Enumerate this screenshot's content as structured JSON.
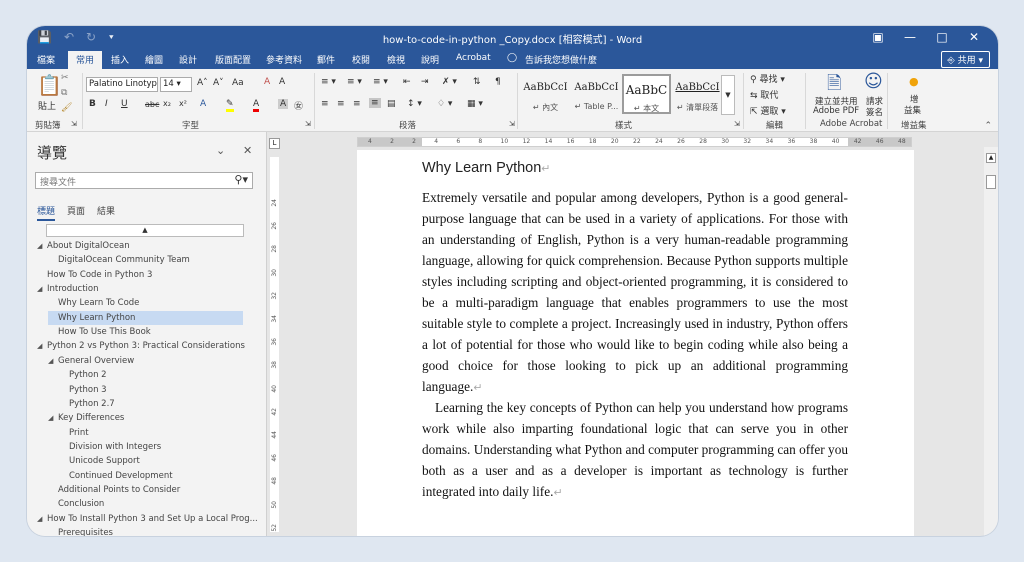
{
  "titlebar": {
    "doc_title": "how-to-code-in-python _Copy.docx [相容模式] - Word",
    "save_icon": "save-icon",
    "customize": "⯆"
  },
  "tabs": [
    "檔案",
    "常用",
    "插入",
    "繪圖",
    "設計",
    "版面配置",
    "參考資料",
    "郵件",
    "校閱",
    "檢視",
    "說明",
    "Acrobat"
  ],
  "active_tab": "常用",
  "tell_me": "告訴我您想做什麼",
  "share_label": "共用",
  "ribbon": {
    "clipboard": {
      "paste_label": "貼上",
      "group_label": "剪貼簿"
    },
    "font": {
      "font_name": "Palatino Linotyp",
      "font_size": "14",
      "group_label": "字型",
      "bold": "B",
      "italic": "I",
      "underline": "U",
      "strike": "abc",
      "sub": "x₂",
      "sup": "x²",
      "grow": "A˄",
      "shrink": "A˅",
      "case": "Aa",
      "clear": "A",
      "effects": "A",
      "color": "A",
      "border_char": "A",
      "phonetic": "A",
      "enclose": "㊛"
    },
    "paragraph": {
      "group_label": "段落"
    },
    "styles": {
      "group_label": "樣式",
      "items": [
        {
          "sample": "AaBbCcI",
          "name": "↵ 內文"
        },
        {
          "sample": "AaBbCcI",
          "name": "↵ Table P..."
        },
        {
          "sample": "AaBbC",
          "name": "↵ 本文"
        },
        {
          "sample": "AaBbCcI",
          "name": "↵ 清單段落"
        }
      ]
    },
    "editing": {
      "find": "尋找",
      "replace": "取代",
      "select": "選取",
      "group_label": "編輯"
    },
    "acrobat": {
      "create_share_1": "建立並共用",
      "create_share_2": "Adobe PDF",
      "request_1": "請求",
      "request_2": "簽名",
      "group_label": "Adobe Acrobat"
    },
    "addins": {
      "label_1": "增",
      "label_2": "益集",
      "group_label": "增益集"
    }
  },
  "nav": {
    "title": "導覽",
    "search_placeholder": "搜尋文件",
    "tabs": [
      "標題",
      "頁面",
      "結果"
    ],
    "collapse_symbol": "▲",
    "items": [
      {
        "level": 0,
        "expand": "◢",
        "label": "About DigitalOcean"
      },
      {
        "level": 1,
        "expand": "",
        "label": "DigitalOcean Community Team"
      },
      {
        "level": 0,
        "expand": "",
        "label": "How To Code in Python 3"
      },
      {
        "level": 0,
        "expand": "◢",
        "label": "Introduction"
      },
      {
        "level": 1,
        "expand": "",
        "label": "Why Learn To Code"
      },
      {
        "level": 1,
        "expand": "",
        "label": "Why Learn Python",
        "selected": true
      },
      {
        "level": 1,
        "expand": "",
        "label": "How To Use This Book"
      },
      {
        "level": 0,
        "expand": "◢",
        "label": "Python 2 vs Python 3: Practical Considerations"
      },
      {
        "level": 1,
        "expand": "◢",
        "label": "General Overview"
      },
      {
        "level": 2,
        "expand": "",
        "label": "Python 2"
      },
      {
        "level": 2,
        "expand": "",
        "label": "Python 3"
      },
      {
        "level": 2,
        "expand": "",
        "label": "Python 2.7"
      },
      {
        "level": 1,
        "expand": "◢",
        "label": "Key Differences"
      },
      {
        "level": 2,
        "expand": "",
        "label": "Print"
      },
      {
        "level": 2,
        "expand": "",
        "label": "Division with Integers"
      },
      {
        "level": 2,
        "expand": "",
        "label": "Unicode Support"
      },
      {
        "level": 2,
        "expand": "",
        "label": "Continued Development"
      },
      {
        "level": 1,
        "expand": "",
        "label": "Additional Points to Consider"
      },
      {
        "level": 1,
        "expand": "",
        "label": "Conclusion"
      },
      {
        "level": 0,
        "expand": "◢",
        "label": "How To Install Python 3 and Set Up a Local Prog..."
      },
      {
        "level": 1,
        "expand": "",
        "label": "Prerequisites"
      }
    ]
  },
  "vruler_ticks": [
    "24",
    "26",
    "28",
    "30",
    "32",
    "34",
    "36",
    "38",
    "40",
    "42",
    "44",
    "46",
    "48",
    "50",
    "52",
    "54"
  ],
  "hruler_ticks": [
    "4",
    "2",
    "2",
    "4",
    "6",
    "8",
    "10",
    "12",
    "14",
    "16",
    "18",
    "20",
    "22",
    "24",
    "26",
    "28",
    "30",
    "32",
    "34",
    "36",
    "38",
    "40",
    "42",
    "46",
    "48"
  ],
  "document": {
    "heading": "Why Learn Python",
    "paragraphs": [
      "Extremely versatile and popular among developers, Python is a good general-purpose language that can be used in a variety of applications. For those with an understanding of English, Python is a very human-readable programming language, allowing for quick comprehension. Because Python supports multiple styles including scripting and object-oriented programming, it is considered to be a multi-paradigm language that enables programmers to use the most suitable style to complete a project. Increasingly used in industry, Python offers a lot of potential for those who would like to begin coding while also being a good choice for those looking to pick up an additional programming language.",
      "Learning the key concepts of Python can help you understand how programs work while also imparting foundational logic that can serve you in other domains. Understanding what Python and computer programming can offer you both as a user and as a developer is important as technology is further integrated into daily life."
    ],
    "para_mark": "↵"
  },
  "colors": {
    "accent": "#2b579a",
    "selected": "#c7daf2"
  }
}
